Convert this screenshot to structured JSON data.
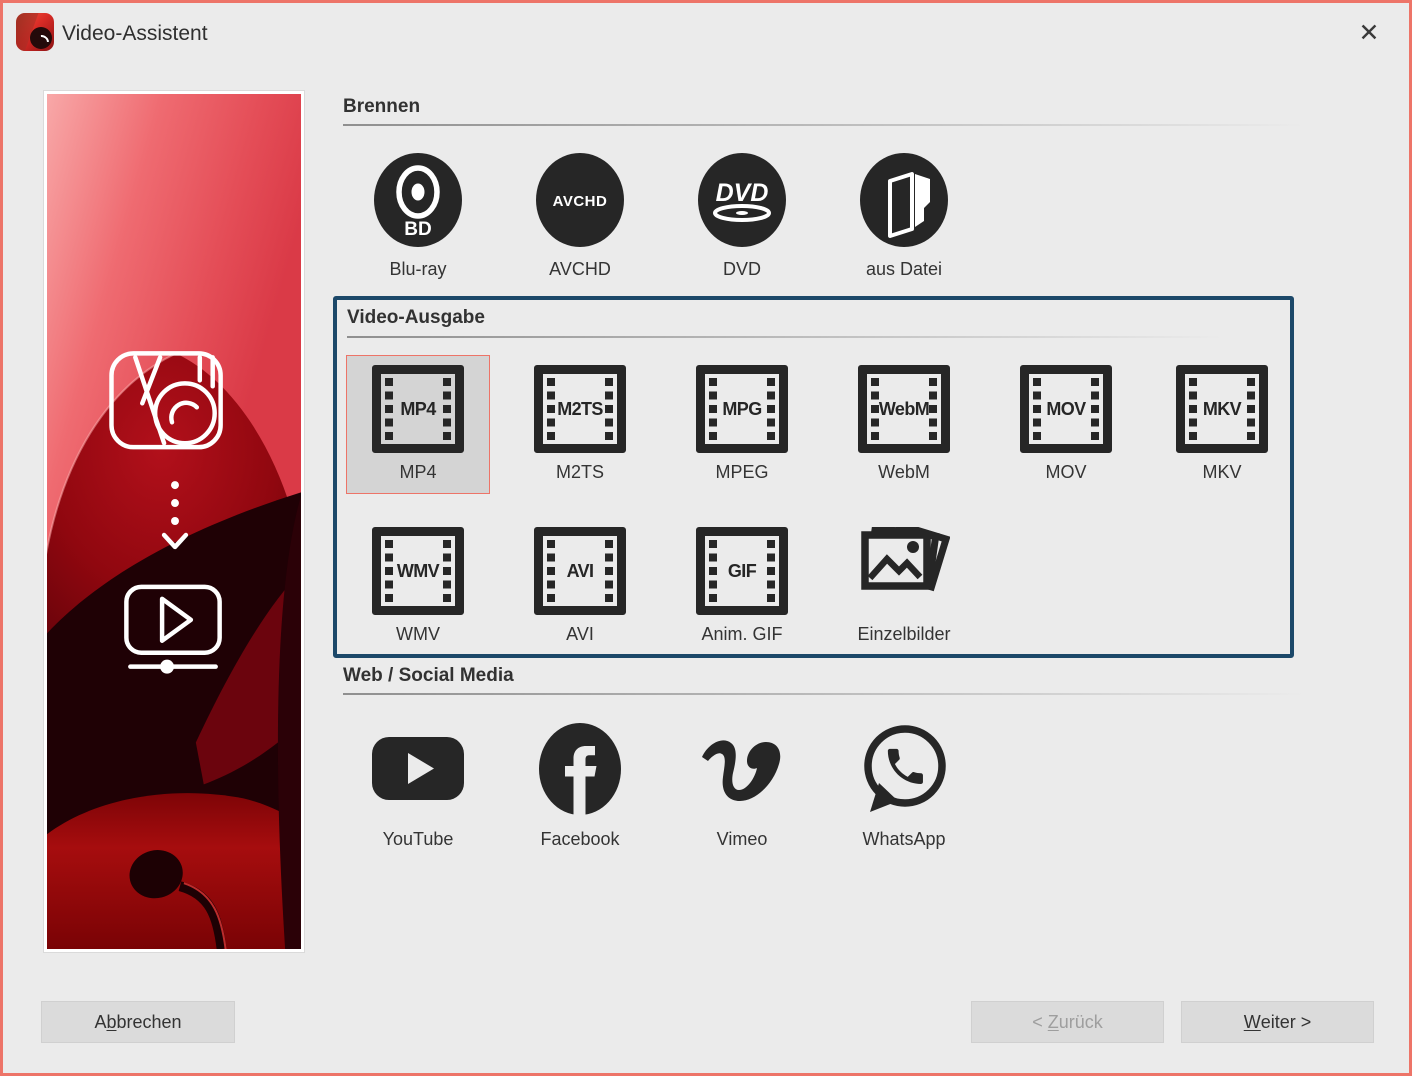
{
  "window": {
    "title": "Video-Assistent",
    "close_glyph": "✕"
  },
  "colors": {
    "window_border": "#ed7468",
    "selection_border": "#ed7468",
    "selection_bg": "#d4d4d4",
    "section_frame_navy": "#1c4869",
    "icon_black": "#262626",
    "background": "#ebebeb"
  },
  "preview": {
    "icons": [
      "app-logo-outline-icon",
      "arrow-down-dots-icon",
      "video-player-icon"
    ]
  },
  "sections": {
    "brennen": {
      "title": "Brennen",
      "items": [
        {
          "label": "Blu-ray",
          "icon": "bluray-disc-icon",
          "icon_text": "BD"
        },
        {
          "label": "AVCHD",
          "icon": "avchd-disc-icon",
          "icon_text": "AVCHD"
        },
        {
          "label": "DVD",
          "icon": "dvd-disc-icon",
          "icon_text": "DVD"
        },
        {
          "label": "aus Datei",
          "icon": "from-file-icon"
        }
      ]
    },
    "video_ausgabe": {
      "title": "Video-Ausgabe",
      "items": [
        {
          "label": "MP4",
          "icon": "film-strip-icon",
          "icon_text": "MP4",
          "selected": true
        },
        {
          "label": "M2TS",
          "icon": "film-strip-icon",
          "icon_text": "M2TS"
        },
        {
          "label": "MPEG",
          "icon": "film-strip-icon",
          "icon_text": "MPG"
        },
        {
          "label": "WebM",
          "icon": "film-strip-icon",
          "icon_text": "WebM"
        },
        {
          "label": "MOV",
          "icon": "film-strip-icon",
          "icon_text": "MOV"
        },
        {
          "label": "MKV",
          "icon": "film-strip-icon",
          "icon_text": "MKV"
        },
        {
          "label": "WMV",
          "icon": "film-strip-icon",
          "icon_text": "WMV"
        },
        {
          "label": "AVI",
          "icon": "film-strip-icon",
          "icon_text": "AVI"
        },
        {
          "label": "Anim. GIF",
          "icon": "film-strip-icon",
          "icon_text": "GIF"
        },
        {
          "label": "Einzelbilder",
          "icon": "image-stack-icon"
        }
      ]
    },
    "web_social": {
      "title": "Web / Social Media",
      "items": [
        {
          "label": "YouTube",
          "icon": "youtube-icon"
        },
        {
          "label": "Facebook",
          "icon": "facebook-icon"
        },
        {
          "label": "Vimeo",
          "icon": "vimeo-icon"
        },
        {
          "label": "WhatsApp",
          "icon": "whatsapp-icon"
        }
      ]
    }
  },
  "footer": {
    "cancel": {
      "pre": "A",
      "mnemonic": "b",
      "post": "brechen"
    },
    "back": {
      "pre": "< ",
      "mnemonic": "Z",
      "post": "urück",
      "disabled": true
    },
    "next": {
      "pre": "",
      "mnemonic": "W",
      "post": "eiter >"
    }
  }
}
